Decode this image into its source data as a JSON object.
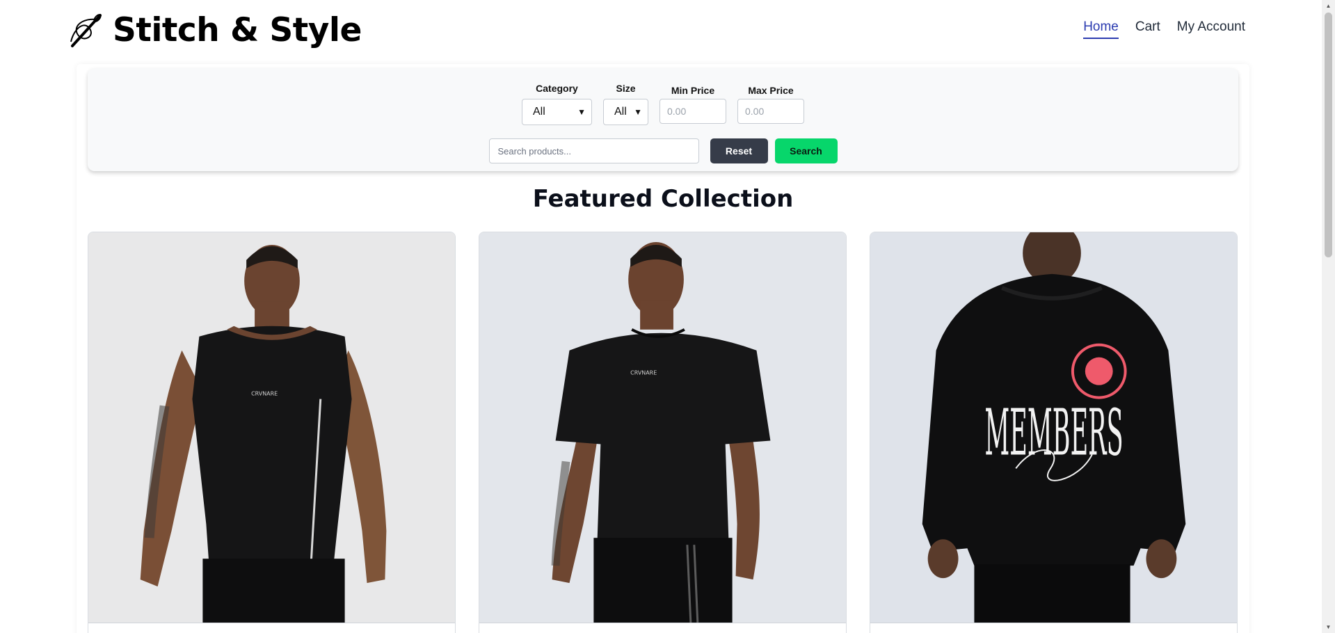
{
  "header": {
    "title": "Stitch & Style",
    "logo_icon": "needle-thread-icon",
    "nav": [
      {
        "label": "Home",
        "active": true
      },
      {
        "label": "Cart",
        "active": false
      },
      {
        "label": "My Account",
        "active": false
      }
    ]
  },
  "filters": {
    "category": {
      "label": "Category",
      "selected": "All"
    },
    "size": {
      "label": "Size",
      "selected": "All"
    },
    "min_price": {
      "label": "Min Price",
      "placeholder": "0.00"
    },
    "max_price": {
      "label": "Max Price",
      "placeholder": "0.00"
    },
    "search": {
      "placeholder": "Search products..."
    },
    "reset_label": "Reset",
    "search_label": "Search"
  },
  "main": {
    "section_title": "Featured Collection",
    "products": [
      {
        "image": "black-sleeveless-tank-top-model"
      },
      {
        "image": "black-short-sleeve-tshirt-model"
      },
      {
        "image": "black-members-only-hoodie-back"
      }
    ]
  },
  "colors": {
    "nav_active": "#2b3bb0",
    "reset_button": "#363c49",
    "search_button": "#07d66b",
    "filter_panel": "#f8f9fa"
  }
}
